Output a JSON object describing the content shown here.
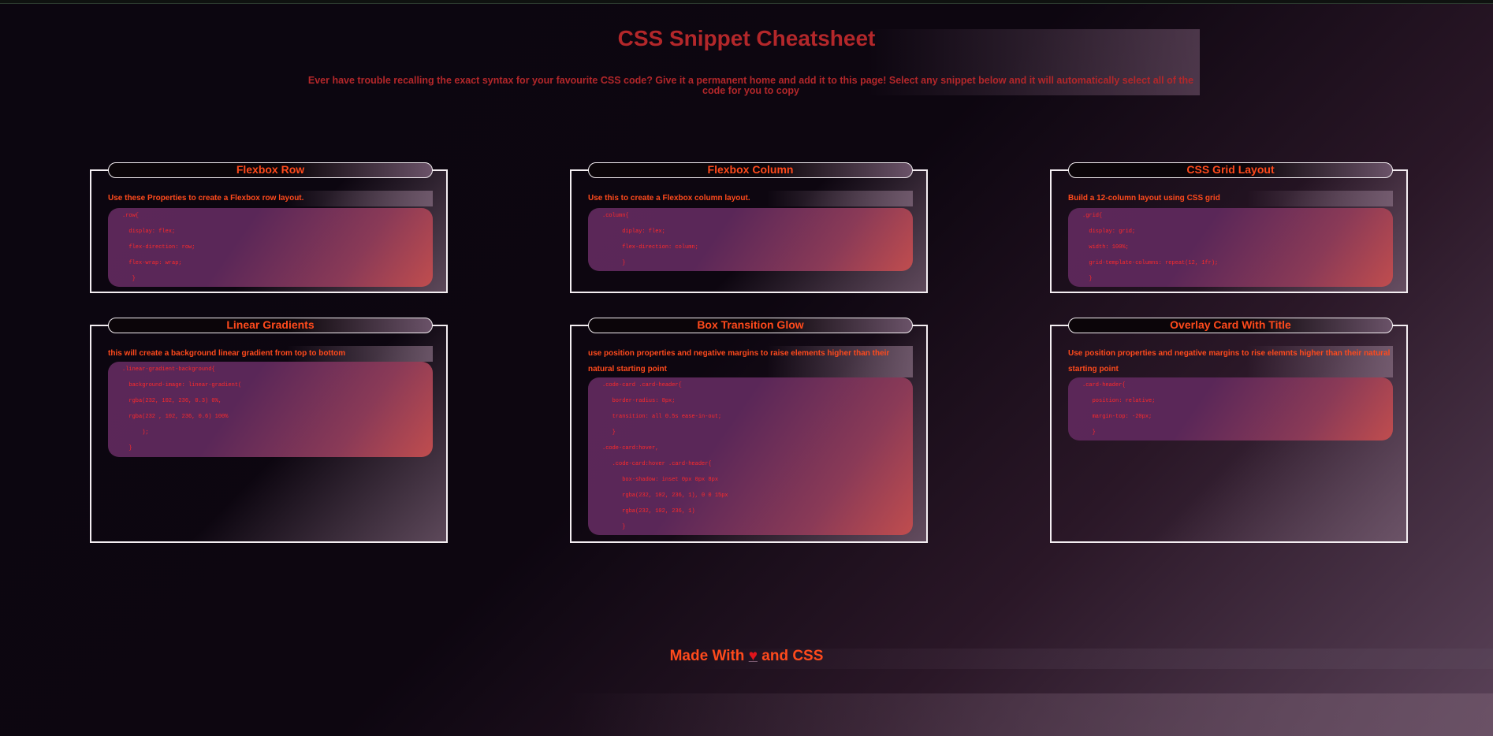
{
  "page": {
    "title": "CSS Snippet Cheatsheet",
    "intro": "Ever have trouble recalling the exact syntax for your favourite CSS code? Give it a permanent home and add it to this page! Select any snippet below and it will automatically select all of the code for you to copy"
  },
  "cards": [
    {
      "title": "Flexbox Row",
      "description": "Use these Properties to create a Flexbox row layout.",
      "code": [
        ".row{",
        "  display: flex;",
        "  flex-direction: row;",
        "  flex-wrap: wrap;",
        "   }"
      ]
    },
    {
      "title": "Flexbox Column",
      "description": "Use this to create a Flexbox column layout.",
      "code": [
        ".column{",
        "      diplay: flex;",
        "      flex-direction: column;",
        "      }"
      ]
    },
    {
      "title": "CSS Grid Layout",
      "description": "Build a 12-column layout using CSS grid",
      "code": [
        ".grid{",
        "  display: grid;",
        "  width: 100%;",
        "  grid-template-columns: repeat(12, 1fr);",
        "  }"
      ]
    },
    {
      "title": "Linear Gradients",
      "description": "this will create a background linear gradient from top to bottom",
      "code": [
        ".linear-gradient-background{",
        "  background-image: linear-gradient(",
        "  rgba(232, 102, 236, 0.3) 0%,",
        "  rgba(232 , 102, 236, 0.6) 100%",
        "      );",
        "  }"
      ]
    },
    {
      "title": "Box Transition Glow",
      "description": "use position properties and negative margins to raise elements higher than their natural starting point",
      "code": [
        ".code-card .card-header{",
        "   border-radius: 8px;",
        "   transition: all 0.5s ease-in-out;",
        "   }",
        ".code-card:hover,",
        "   .code-card:hover .card-header{",
        "      box-shadow: inset 0px 0px 8px",
        "      rgba(232, 102, 236, 1), 0 0 15px",
        "      rgba(232, 102, 236, 1)",
        "      }"
      ]
    },
    {
      "title": "Overlay Card With Title",
      "description": "Use position properties and negative margins to rise elemnts higher than their natural starting point",
      "code": [
        ".card-header{",
        "   position: relative;",
        "   margin-top: -20px;",
        "   }"
      ]
    }
  ],
  "footer": {
    "prefix": "Made With",
    "heart": "♥",
    "suffix": "and CSS"
  },
  "colors": {
    "accent": "#ff4a1c",
    "title": "#b3272a",
    "code_text": "#ff2a2a",
    "border": "#f4eef2"
  }
}
